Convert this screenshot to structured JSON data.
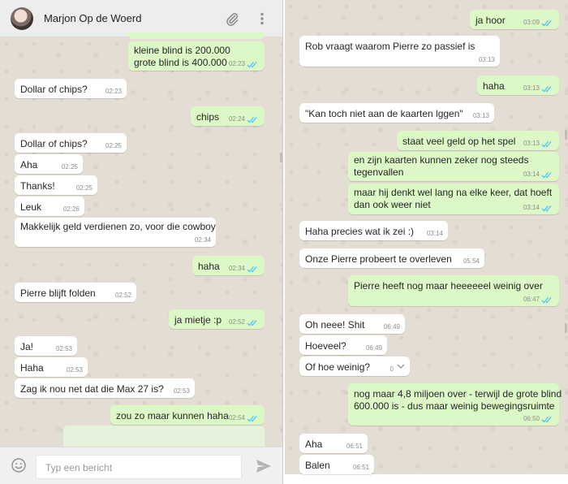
{
  "left": {
    "header": {
      "contact_name": "Marjon Op de Woerd",
      "icons": [
        "avatar",
        "paperclip-icon",
        "menu-dots-icon"
      ]
    },
    "composer": {
      "placeholder": "Typ een bericht",
      "icons": [
        "emoji-icon",
        "send-icon"
      ]
    },
    "messages": [
      {
        "dir": "out",
        "lines": [
          "kleine blind is 200.000",
          "grote blind is 400.000"
        ],
        "time": "02:23"
      },
      {
        "dir": "in",
        "lines": [
          "Dollar of chips?"
        ],
        "time": "02:23"
      },
      {
        "dir": "out",
        "lines": [
          "chips"
        ],
        "time": "02:24"
      },
      {
        "dir": "in",
        "lines": [
          "Dollar of chips?"
        ],
        "time": "02:25"
      },
      {
        "dir": "in",
        "lines": [
          "Aha"
        ],
        "time": "02:25"
      },
      {
        "dir": "in",
        "lines": [
          "Thanks!"
        ],
        "time": "02:25"
      },
      {
        "dir": "in",
        "lines": [
          "Leuk"
        ],
        "time": "02:26"
      },
      {
        "dir": "in",
        "lines": [
          "Makkelijk geld verdienen zo, voor die cowboy"
        ],
        "time": "02:34"
      },
      {
        "dir": "out",
        "lines": [
          "haha"
        ],
        "time": "02:34"
      },
      {
        "dir": "in",
        "lines": [
          "Pierre blijft folden"
        ],
        "time": "02:52"
      },
      {
        "dir": "out",
        "lines": [
          "ja mietje :p"
        ],
        "time": "02:52"
      },
      {
        "dir": "in",
        "lines": [
          "Ja!"
        ],
        "time": "02:53"
      },
      {
        "dir": "in",
        "lines": [
          "Haha"
        ],
        "time": "02:53"
      },
      {
        "dir": "in",
        "lines": [
          "Zag ik nou net dat die Max 27 is?"
        ],
        "time": "02:53"
      },
      {
        "dir": "out",
        "lines": [
          "zou zo maar kunnen haha"
        ],
        "time": "02:54"
      }
    ]
  },
  "right": {
    "messages": [
      {
        "dir": "out",
        "lines": [
          "ja hoor"
        ],
        "time": "03:09"
      },
      {
        "dir": "in",
        "lines": [
          "Rob vraagt waarom Pierre zo passief is"
        ],
        "time": "03:13"
      },
      {
        "dir": "out",
        "lines": [
          "haha"
        ],
        "time": "03:13"
      },
      {
        "dir": "in",
        "lines": [
          "\"Kan toch niet aan de kaarten lggen\""
        ],
        "time": "03:13"
      },
      {
        "dir": "out",
        "lines": [
          "staat veel geld op het spel"
        ],
        "time": "03:13"
      },
      {
        "dir": "out",
        "lines": [
          "en zijn kaarten kunnen zeker nog steeds",
          "tegenvallen"
        ],
        "time": "03:14"
      },
      {
        "dir": "out",
        "lines": [
          "maar hij denkt wel lang na elke keer, dat hoeft",
          "dan ook weer niet"
        ],
        "time": "03:14"
      },
      {
        "dir": "in",
        "lines": [
          "Haha precies wat ik zei :)"
        ],
        "time": "03:14"
      },
      {
        "dir": "in",
        "lines": [
          "Onze Pierre probeert te overleven"
        ],
        "time": "05:54"
      },
      {
        "dir": "out",
        "lines": [
          "Pierre heeft nog maar heeeeeel weinig over"
        ],
        "time": "06:47"
      },
      {
        "dir": "in",
        "lines": [
          "Oh neee! Shit"
        ],
        "time": "06:49"
      },
      {
        "dir": "in",
        "lines": [
          "Hoeveel?"
        ],
        "time": "06:49"
      },
      {
        "dir": "in",
        "lines": [
          "Of hoe weinig?"
        ],
        "time": "0"
      },
      {
        "dir": "out",
        "lines": [
          "nog maar 4,8 miljoen over - terwijl de grote blind",
          "600.000 is - dus maar weinig bewegingsruimte"
        ],
        "time": "06:50"
      },
      {
        "dir": "in",
        "lines": [
          "Aha"
        ],
        "time": "06:51"
      },
      {
        "dir": "in",
        "lines": [
          "Balen"
        ],
        "time": "06:51"
      }
    ]
  },
  "colors": {
    "wallpaper": "#e3ddd4",
    "incoming_bubble": "#ffffff",
    "outgoing_bubble": "#dcf8c6",
    "read_ticks": "#4fc3f7",
    "header_bg": "#ededed"
  }
}
